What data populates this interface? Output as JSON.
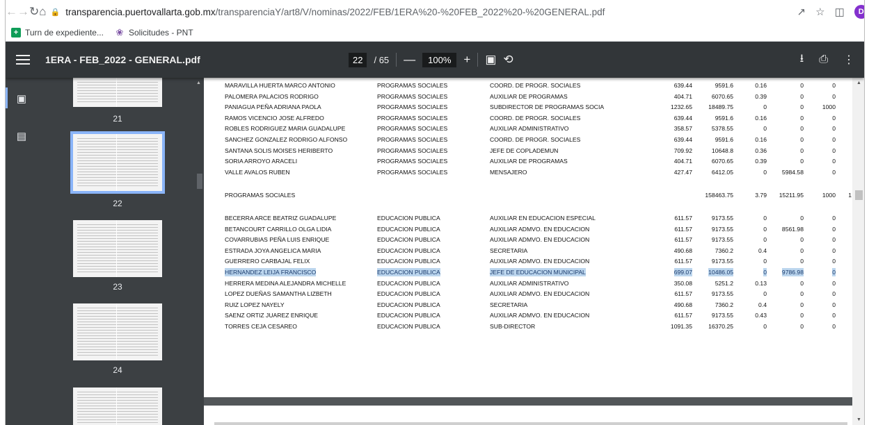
{
  "browser": {
    "url_host": "transparencia.puertovallarta.gob.mx",
    "url_path": "/transparenciaY/art8/V/nominas/2022/FEB/1ERA%20-%20FEB_2022%20-%20GENERAL.pdf",
    "profile_initial": "D",
    "bookmarks": [
      {
        "label": "Turn de expediente..."
      },
      {
        "label": "Solicitudes - PNT"
      }
    ]
  },
  "pdf": {
    "title": "1ERA - FEB_2022 - GENERAL.pdf",
    "current_page": "22",
    "total_pages": "/ 65",
    "zoom": "100%",
    "thumbnails": [
      "21",
      "22",
      "23",
      "24"
    ]
  },
  "table": {
    "rows_sociales": [
      {
        "name": "MARAVILLA HUERTA MARCO ANTONIO",
        "dept": "PROGRAMAS SOCIALES",
        "job": "COORD. DE PROGR. SOCIALES",
        "v1": "639.44",
        "v2": "9591.6",
        "v3": "0.16",
        "v4": "0",
        "v5": "0"
      },
      {
        "name": "PALOMERA PALACIOS RODRIGO",
        "dept": "PROGRAMAS SOCIALES",
        "job": "AUXILIAR DE PROGRAMAS",
        "v1": "404.71",
        "v2": "6070.65",
        "v3": "0.39",
        "v4": "0",
        "v5": "0"
      },
      {
        "name": "PANIAGUA PEÑA ADRIANA PAOLA",
        "dept": "PROGRAMAS SOCIALES",
        "job": "SUBDIRECTOR DE PROGRAMAS SOCIA",
        "v1": "1232.65",
        "v2": "18489.75",
        "v3": "0",
        "v4": "0",
        "v5": "1000"
      },
      {
        "name": "RAMOS VICENCIO JOSE ALFREDO",
        "dept": "PROGRAMAS SOCIALES",
        "job": "COORD. DE PROGR. SOCIALES",
        "v1": "639.44",
        "v2": "9591.6",
        "v3": "0.16",
        "v4": "0",
        "v5": "0"
      },
      {
        "name": "ROBLES RODRIGUEZ MARIA GUADALUPE",
        "dept": "PROGRAMAS SOCIALES",
        "job": "AUXILIAR ADMINISTRATIVO",
        "v1": "358.57",
        "v2": "5378.55",
        "v3": "0",
        "v4": "0",
        "v5": "0"
      },
      {
        "name": "SANCHEZ GONZALEZ RODRIGO ALFONSO",
        "dept": "PROGRAMAS SOCIALES",
        "job": "COORD. DE PROGR. SOCIALES",
        "v1": "639.44",
        "v2": "9591.6",
        "v3": "0.16",
        "v4": "0",
        "v5": "0"
      },
      {
        "name": "SANTANA SOLIS MOISES HERIBERTO",
        "dept": "PROGRAMAS SOCIALES",
        "job": "JEFE DE COPLADEMUN",
        "v1": "709.92",
        "v2": "10648.8",
        "v3": "0.36",
        "v4": "0",
        "v5": "0"
      },
      {
        "name": "SORIA ARROYO ARACELI",
        "dept": "PROGRAMAS SOCIALES",
        "job": "AUXILIAR DE PROGRAMAS",
        "v1": "404.71",
        "v2": "6070.65",
        "v3": "0.39",
        "v4": "0",
        "v5": "0"
      },
      {
        "name": "VALLE AVALOS RUBEN",
        "dept": "PROGRAMAS SOCIALES",
        "job": "MENSAJERO",
        "v1": "427.47",
        "v2": "6412.05",
        "v3": "0",
        "v4": "5984.58",
        "v5": "0"
      }
    ],
    "subtotal": {
      "label": "PROGRAMAS SOCIALES",
      "v2": "158463.75",
      "v3": "3.79",
      "v4": "15211.95",
      "v5": "1000",
      "v6": "1"
    },
    "rows_educacion": [
      {
        "name": "BECERRA ARCE BEATRIZ GUADALUPE",
        "dept": "EDUCACION PUBLICA",
        "job": "AUXILIAR EN EDUCACION ESPECIAL",
        "v1": "611.57",
        "v2": "9173.55",
        "v3": "0",
        "v4": "0",
        "v5": "0"
      },
      {
        "name": "BETANCOURT CARRILLO OLGA LIDIA",
        "dept": "EDUCACION PUBLICA",
        "job": "AUXILIAR ADMVO. EN EDUCACION",
        "v1": "611.57",
        "v2": "9173.55",
        "v3": "0",
        "v4": "8561.98",
        "v5": "0"
      },
      {
        "name": "COVARRUBIAS PEÑA LUIS ENRIQUE",
        "dept": "EDUCACION PUBLICA",
        "job": "AUXILIAR ADMVO. EN EDUCACION",
        "v1": "611.57",
        "v2": "9173.55",
        "v3": "0",
        "v4": "0",
        "v5": "0"
      },
      {
        "name": "ESTRADA JOYA ANGELICA MARIA",
        "dept": "EDUCACION PUBLICA",
        "job": "SECRETARIA",
        "v1": "490.68",
        "v2": "7360.2",
        "v3": "0.4",
        "v4": "0",
        "v5": "0"
      },
      {
        "name": "GUERRERO CARBAJAL FELIX",
        "dept": "EDUCACION PUBLICA",
        "job": "AUXILIAR ADMVO. EN EDUCACION",
        "v1": "611.57",
        "v2": "9173.55",
        "v3": "0",
        "v4": "0",
        "v5": "0"
      },
      {
        "name": "HERNANDEZ LEIJA FRANCISCO",
        "dept": "EDUCACION PUBLICA",
        "job": "JEFE DE EDUCACION MUNICIPAL",
        "v1": "699.07",
        "v2": "10486.05",
        "v3": "0",
        "v4": "9786.98",
        "v5": "0",
        "highlight": true
      },
      {
        "name": "HERRERA MEDINA ALEJANDRA MICHELLE",
        "dept": "EDUCACION PUBLICA",
        "job": "AUXILIAR ADMINISTRATIVO",
        "v1": "350.08",
        "v2": "5251.2",
        "v3": "0.13",
        "v4": "0",
        "v5": "0"
      },
      {
        "name": "LOPEZ DUEÑAS SAMANTHA LIZBETH",
        "dept": "EDUCACION PUBLICA",
        "job": "AUXILIAR ADMVO. EN EDUCACION",
        "v1": "611.57",
        "v2": "9173.55",
        "v3": "0",
        "v4": "0",
        "v5": "0"
      },
      {
        "name": "RUIZ LOPEZ NAYELY",
        "dept": "EDUCACION PUBLICA",
        "job": "SECRETARIA",
        "v1": "490.68",
        "v2": "7360.2",
        "v3": "0.4",
        "v4": "0",
        "v5": "0"
      },
      {
        "name": "SAENZ ORTIZ JUAREZ ENRIQUE",
        "dept": "EDUCACION PUBLICA",
        "job": "AUXILIAR ADMVO. EN EDUCACION",
        "v1": "611.57",
        "v2": "9173.55",
        "v3": "0.43",
        "v4": "0",
        "v5": "0"
      },
      {
        "name": "TORRES CEJA CESAREO",
        "dept": "EDUCACION PUBLICA",
        "job": "SUB-DIRECTOR",
        "v1": "1091.35",
        "v2": "16370.25",
        "v3": "0",
        "v4": "0",
        "v5": "0"
      }
    ]
  },
  "colors": {
    "toolbar": "#323639",
    "sidebar": "#3c4043",
    "viewer_bg": "#525659",
    "selection": "#bcd6ee",
    "thumb_selected": "#8ab4f8"
  },
  "icons": [
    "back-arrow-icon",
    "forward-arrow-icon",
    "reload-icon",
    "home-icon",
    "lock-icon",
    "share-icon",
    "star-icon",
    "sidepanel-icon",
    "kebab-menu-icon",
    "menu-icon",
    "zoom-out-icon",
    "zoom-in-icon",
    "fit-page-icon",
    "rotate-icon",
    "download-icon",
    "print-icon",
    "more-icon",
    "thumbnails-icon",
    "outline-icon"
  ]
}
